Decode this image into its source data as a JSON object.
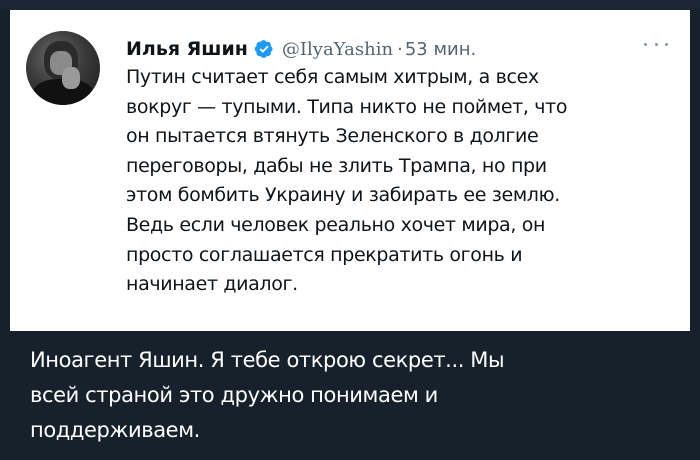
{
  "tweet": {
    "author_name": "Илья Яшин",
    "handle": "@IlyaYashin",
    "separator": "·",
    "time": "53 мин.",
    "text_lines": [
      "Путин считает себя самым хитрым, а всех",
      "вокруг — тупыми. Типа никто не поймет, что",
      "он пытается втянуть Зеленского в долгие",
      "переговоры, дабы не злить Трампа, но при",
      "этом бомбить Украину и забирать ее землю.",
      "Ведь если человек реально хочет мира, он",
      "просто соглашается прекратить огонь и",
      "начинает диалог."
    ],
    "verified_icon": "verified-badge-icon",
    "more_icon": "more-options-icon",
    "colors": {
      "verified": "#1d9bf0",
      "muted": "#536471",
      "text": "#0f1419"
    }
  },
  "message": {
    "text_lines": [
      "Иноагент Яшин. Я тебе открою секрет... Мы",
      "всей страной это дружно понимаем и",
      "поддерживаем."
    ],
    "colors": {
      "background": "#17212b",
      "text": "#ffffff"
    }
  }
}
